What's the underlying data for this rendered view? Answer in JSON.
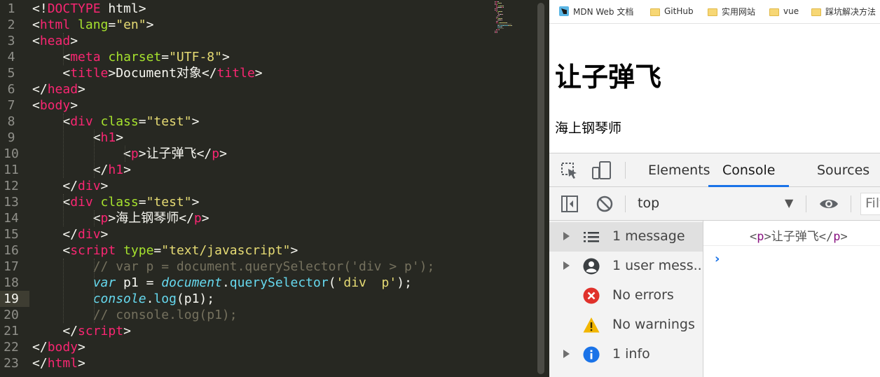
{
  "editor": {
    "line_numbers": [
      "1",
      "2",
      "3",
      "4",
      "5",
      "6",
      "7",
      "8",
      "9",
      "10",
      "11",
      "12",
      "13",
      "14",
      "15",
      "16",
      "17",
      "18",
      "19",
      "20",
      "21",
      "22",
      "23"
    ],
    "active_line": "19",
    "lines": [
      [
        [
          "t-txt",
          "<!"
        ],
        [
          "t-tag",
          "DOCTYPE"
        ],
        [
          "t-txt",
          " html>"
        ]
      ],
      [
        [
          "t-txt",
          "<"
        ],
        [
          "t-tag",
          "html"
        ],
        [
          "t-txt",
          " "
        ],
        [
          "t-attr",
          "lang"
        ],
        [
          "t-txt",
          "="
        ],
        [
          "t-str",
          "\"en\""
        ],
        [
          "t-txt",
          ">"
        ]
      ],
      [
        [
          "t-txt",
          "<"
        ],
        [
          "t-tag",
          "head"
        ],
        [
          "t-txt",
          ">"
        ]
      ],
      [
        [
          "t-txt",
          "    <"
        ],
        [
          "t-tag",
          "meta"
        ],
        [
          "t-txt",
          " "
        ],
        [
          "t-attr",
          "charset"
        ],
        [
          "t-txt",
          "="
        ],
        [
          "t-str",
          "\"UTF-8\""
        ],
        [
          "t-txt",
          ">"
        ]
      ],
      [
        [
          "t-txt",
          "    <"
        ],
        [
          "t-tag",
          "title"
        ],
        [
          "t-txt",
          ">Document对象</"
        ],
        [
          "t-tag",
          "title"
        ],
        [
          "t-txt",
          ">"
        ]
      ],
      [
        [
          "t-txt",
          "</"
        ],
        [
          "t-tag",
          "head"
        ],
        [
          "t-txt",
          ">"
        ]
      ],
      [
        [
          "t-txt",
          "<"
        ],
        [
          "t-tag",
          "body"
        ],
        [
          "t-txt",
          ">"
        ]
      ],
      [
        [
          "t-txt",
          "    <"
        ],
        [
          "t-tag",
          "div"
        ],
        [
          "t-txt",
          " "
        ],
        [
          "t-attr",
          "class"
        ],
        [
          "t-txt",
          "="
        ],
        [
          "t-str",
          "\"test\""
        ],
        [
          "t-txt",
          ">"
        ]
      ],
      [
        [
          "t-txt",
          "        <"
        ],
        [
          "t-tag",
          "h1"
        ],
        [
          "t-txt",
          ">"
        ]
      ],
      [
        [
          "t-txt",
          "            <"
        ],
        [
          "t-tag",
          "p"
        ],
        [
          "t-txt",
          ">让子弹飞</"
        ],
        [
          "t-tag",
          "p"
        ],
        [
          "t-txt",
          ">"
        ]
      ],
      [
        [
          "t-txt",
          "        </"
        ],
        [
          "t-tag",
          "h1"
        ],
        [
          "t-txt",
          ">"
        ]
      ],
      [
        [
          "t-txt",
          "    </"
        ],
        [
          "t-tag",
          "div"
        ],
        [
          "t-txt",
          ">"
        ]
      ],
      [
        [
          "t-txt",
          "    <"
        ],
        [
          "t-tag",
          "div"
        ],
        [
          "t-txt",
          " "
        ],
        [
          "t-attr",
          "class"
        ],
        [
          "t-txt",
          "="
        ],
        [
          "t-str",
          "\"test\""
        ],
        [
          "t-txt",
          ">"
        ]
      ],
      [
        [
          "t-txt",
          "        <"
        ],
        [
          "t-tag",
          "p"
        ],
        [
          "t-txt",
          ">海上钢琴师</"
        ],
        [
          "t-tag",
          "p"
        ],
        [
          "t-txt",
          ">"
        ]
      ],
      [
        [
          "t-txt",
          "    </"
        ],
        [
          "t-tag",
          "div"
        ],
        [
          "t-txt",
          ">"
        ]
      ],
      [
        [
          "t-txt",
          "    <"
        ],
        [
          "t-tag",
          "script"
        ],
        [
          "t-txt",
          " "
        ],
        [
          "t-attr",
          "type"
        ],
        [
          "t-txt",
          "="
        ],
        [
          "t-str",
          "\"text/javascript\""
        ],
        [
          "t-txt",
          ">"
        ]
      ],
      [
        [
          "t-cmt",
          "        // var p = document.querySelector('div > p');"
        ]
      ],
      [
        [
          "t-txt",
          "        "
        ],
        [
          "t-kw",
          "var"
        ],
        [
          "t-txt",
          " p1 = "
        ],
        [
          "t-kw",
          "document"
        ],
        [
          "t-txt",
          "."
        ],
        [
          "t-fn",
          "querySelector"
        ],
        [
          "t-txt",
          "("
        ],
        [
          "t-str",
          "'div  p'"
        ],
        [
          "t-txt",
          ");"
        ]
      ],
      [
        [
          "t-txt",
          "        "
        ],
        [
          "t-kw",
          "console"
        ],
        [
          "t-txt",
          "."
        ],
        [
          "t-fn",
          "log"
        ],
        [
          "t-txt",
          "(p1);"
        ]
      ],
      [
        [
          "t-cmt",
          "        // console.log(p1);"
        ]
      ],
      [
        [
          "t-txt",
          "    </"
        ],
        [
          "t-tag",
          "script"
        ],
        [
          "t-txt",
          ">"
        ]
      ],
      [
        [
          "t-txt",
          "</"
        ],
        [
          "t-tag",
          "body"
        ],
        [
          "t-txt",
          ">"
        ]
      ],
      [
        [
          "t-txt",
          "</"
        ],
        [
          "t-tag",
          "html"
        ],
        [
          "t-txt",
          ">"
        ]
      ]
    ]
  },
  "bookmarks": [
    {
      "label": "MDN Web 文档",
      "icon": "mdn-icon"
    },
    {
      "label": "GitHub",
      "icon": "folder-icon"
    },
    {
      "label": "实用网站",
      "icon": "folder-icon"
    },
    {
      "label": "vue",
      "icon": "folder-icon"
    },
    {
      "label": "踩坑解决方法",
      "icon": "folder-icon"
    }
  ],
  "page": {
    "h1_text": "让子弹飞",
    "p_text": "海上钢琴师"
  },
  "devtools": {
    "tabs": [
      "Elements",
      "Console",
      "Sources"
    ],
    "active_tab": "Console",
    "context": "top",
    "filter_placeholder": "Filter",
    "sidebar": [
      {
        "label": "1 message",
        "icon": "list-icon",
        "expandable": true
      },
      {
        "label": "1 user mess...",
        "icon": "user-icon",
        "expandable": true
      },
      {
        "label": "No errors",
        "icon": "error-icon",
        "expandable": false
      },
      {
        "label": "No warnings",
        "icon": "warning-icon",
        "expandable": false
      },
      {
        "label": "1 info",
        "icon": "info-icon",
        "expandable": true
      }
    ],
    "log_output": {
      "open": "<",
      "tag": "p",
      "close1": ">",
      "text": "让子弹飞",
      "open2": "</",
      "tag2": "p",
      "close2": ">"
    },
    "prompt": "›"
  },
  "colors": {
    "editor_bg": "#272822",
    "tag": "#f92672",
    "attr": "#a6e22e",
    "string": "#e6db74",
    "comment": "#75715e",
    "keyword": "#66d9ef",
    "devtools_accent": "#1a73e8",
    "error": "#e0312b",
    "warning": "#f2b600",
    "info": "#1a73e8"
  }
}
